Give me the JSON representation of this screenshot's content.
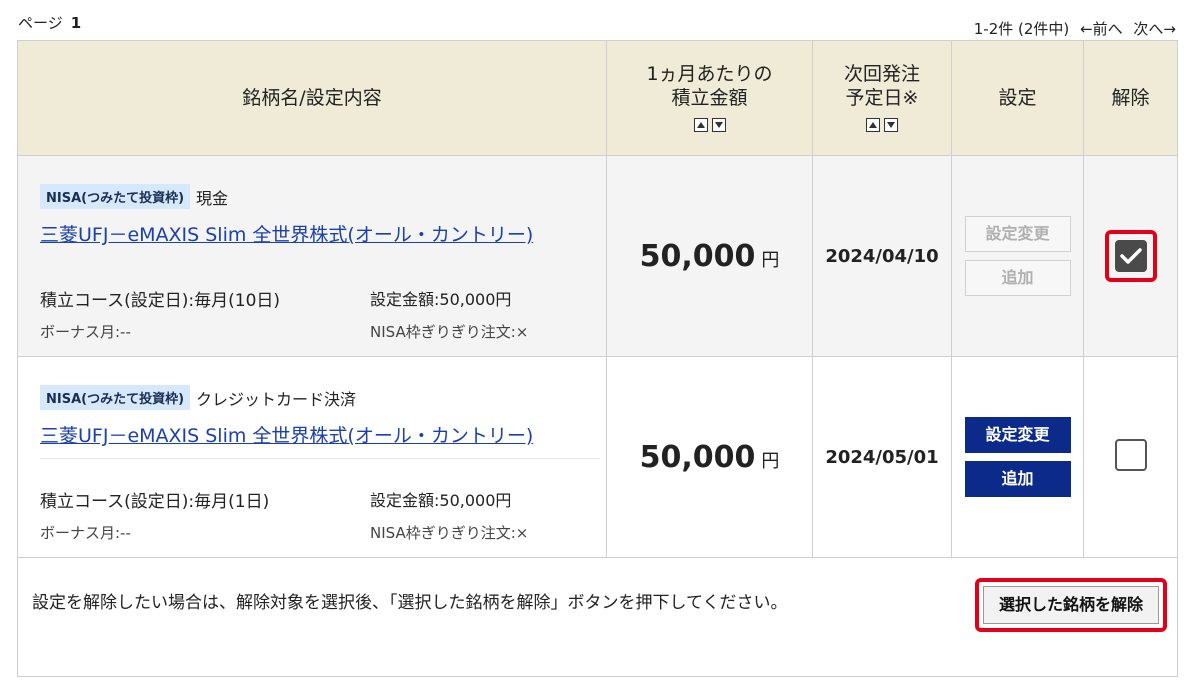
{
  "header": {
    "page_label": "ページ",
    "page_number": "1",
    "range": "1-2件 (2件中)",
    "prev": "←前へ",
    "next": "次へ→"
  },
  "columns": {
    "fund": "銘柄名/設定内容",
    "monthly_line1": "1ヵ月あたりの",
    "monthly_line2": "積立金額",
    "next_date_line1": "次回発注",
    "next_date_line2": "予定日※",
    "settings": "設定",
    "cancel": "解除"
  },
  "rows": [
    {
      "tag": "NISA(つみたて投資枠)",
      "payment": "現金",
      "fund_name": "三菱UFJ－eMAXIS Slim 全世界株式(オール・カントリー)",
      "course": "積立コース(設定日):毎月(10日)",
      "amount_label": "設定金額:50,000円",
      "bonus": "ボーナス月:--",
      "nisa_order": "NISA枠ぎりぎり注文:×",
      "monthly_amount": "50,000",
      "unit": "円",
      "next_date": "2024/04/10",
      "change_button": "設定変更",
      "add_button": "追加",
      "buttons_enabled": false,
      "checked": true
    },
    {
      "tag": "NISA(つみたて投資枠)",
      "payment": "クレジットカード決済",
      "fund_name": "三菱UFJ－eMAXIS Slim 全世界株式(オール・カントリー)",
      "course": "積立コース(設定日):毎月(1日)",
      "amount_label": "設定金額:50,000円",
      "bonus": "ボーナス月:--",
      "nisa_order": "NISA枠ぎりぎり注文:×",
      "monthly_amount": "50,000",
      "unit": "円",
      "next_date": "2024/05/01",
      "change_button": "設定変更",
      "add_button": "追加",
      "buttons_enabled": true,
      "checked": false
    }
  ],
  "footer": {
    "note": "設定を解除したい場合は、解除対象を選択後、「選択した銘柄を解除」ボタンを押下してください。",
    "release_button": "選択した銘柄を解除"
  },
  "colors": {
    "header_bg": "#efebd6",
    "link": "#1a3fae",
    "button_active": "#0c2a8a",
    "highlight": "#e3001b",
    "nisa_tag_bg": "#d6e8fb"
  }
}
